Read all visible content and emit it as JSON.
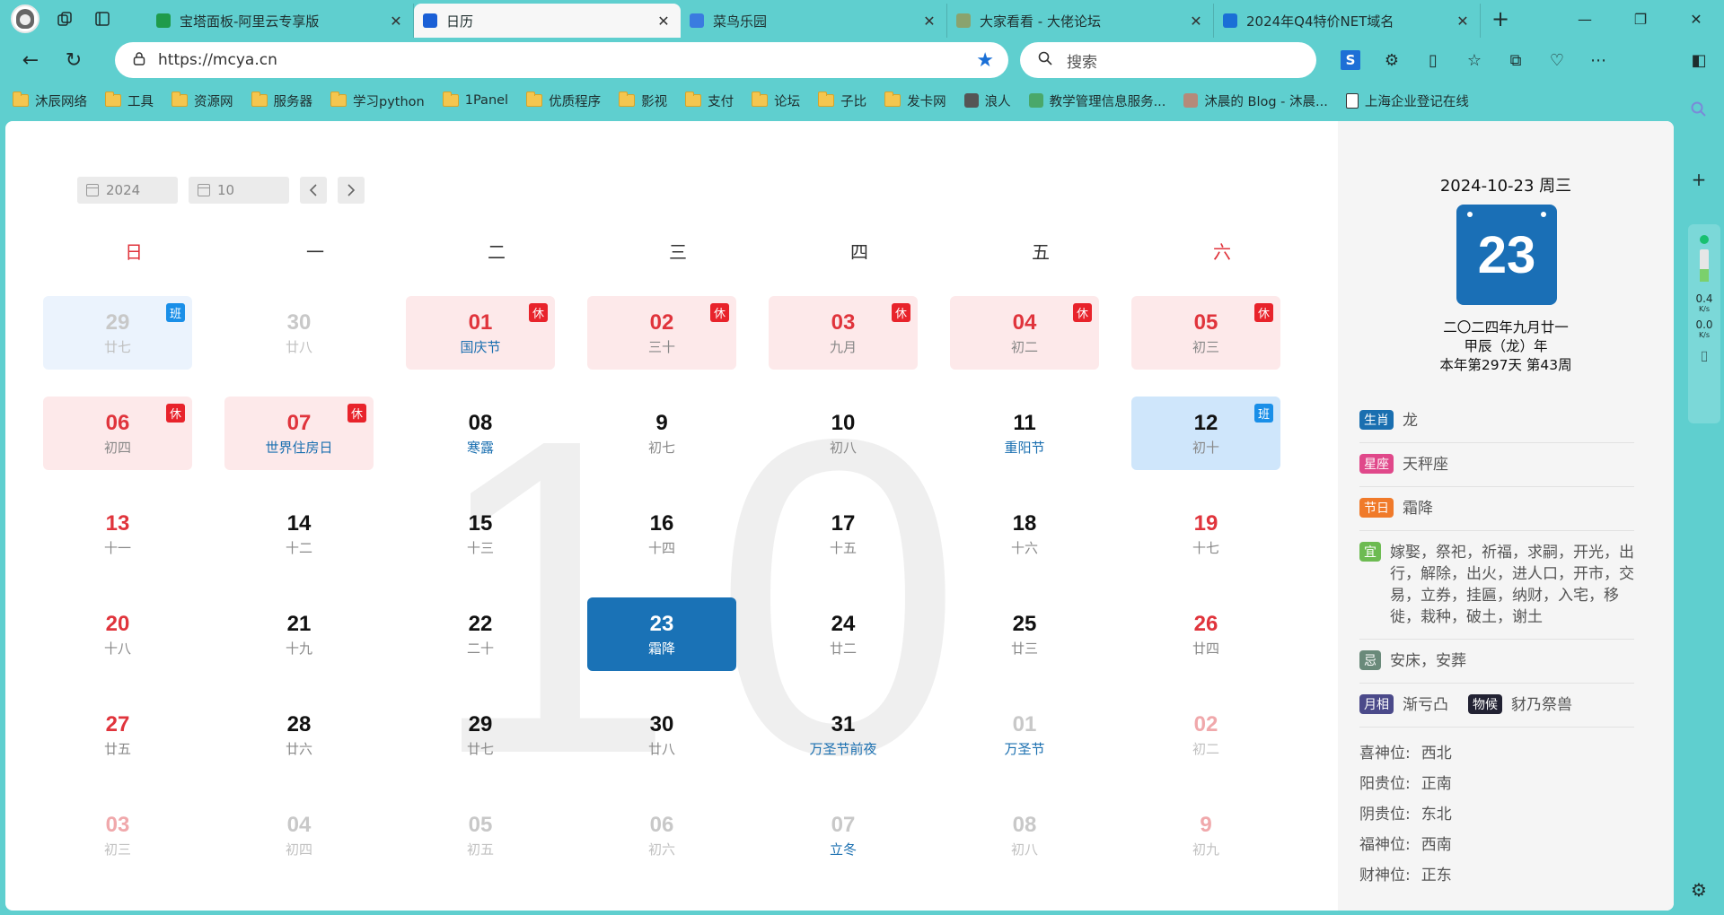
{
  "browser": {
    "tabs": [
      {
        "title": "宝塔面板-阿里云专享版",
        "favicon_color": "#1f9b4b",
        "active": false
      },
      {
        "title": "日历",
        "favicon_color": "#1a5fd6",
        "active": true
      },
      {
        "title": "菜鸟乐园",
        "favicon_color": "#3a7be0",
        "active": false
      },
      {
        "title": "大家看看 - 大佬论坛",
        "favicon_color": "#8aa36e",
        "active": false
      },
      {
        "title": "2024年Q4特价NET域名",
        "favicon_color": "#1a6fd6",
        "active": false
      }
    ],
    "url": "https://mcya.cn",
    "search_placeholder": "搜索",
    "bookmarks": [
      {
        "label": "沐辰网络",
        "type": "folder"
      },
      {
        "label": "工具",
        "type": "folder"
      },
      {
        "label": "资源网",
        "type": "folder"
      },
      {
        "label": "服务器",
        "type": "folder"
      },
      {
        "label": "学习python",
        "type": "folder"
      },
      {
        "label": "1Panel",
        "type": "folder"
      },
      {
        "label": "优质程序",
        "type": "folder"
      },
      {
        "label": "影视",
        "type": "folder"
      },
      {
        "label": "支付",
        "type": "folder"
      },
      {
        "label": "论坛",
        "type": "folder"
      },
      {
        "label": "子比",
        "type": "folder"
      },
      {
        "label": "发卡网",
        "type": "folder"
      },
      {
        "label": "浪人",
        "type": "site"
      },
      {
        "label": "教学管理信息服务...",
        "type": "site"
      },
      {
        "label": "沐晨的 Blog - 沐晨...",
        "type": "site"
      },
      {
        "label": "上海企业登记在线",
        "type": "doc"
      }
    ],
    "net_up": "0.4",
    "net_down": "0.0",
    "net_unit": "K/s"
  },
  "calendar": {
    "year": "2024",
    "month": "10",
    "big_month": "10",
    "weekdays": [
      "日",
      "一",
      "二",
      "三",
      "四",
      "五",
      "六"
    ],
    "days": [
      {
        "num": "29",
        "sub": "廿七",
        "style": "lightblue",
        "numColor": "gray",
        "subColor": "gray",
        "badge": "班"
      },
      {
        "num": "30",
        "sub": "廿八",
        "style": "",
        "numColor": "gray",
        "subColor": "gray"
      },
      {
        "num": "01",
        "sub": "国庆节",
        "style": "pink",
        "numColor": "red",
        "fest": true,
        "badge": "休"
      },
      {
        "num": "02",
        "sub": "三十",
        "style": "pink",
        "numColor": "red",
        "badge": "休"
      },
      {
        "num": "03",
        "sub": "九月",
        "style": "pink",
        "numColor": "red",
        "badge": "休"
      },
      {
        "num": "04",
        "sub": "初二",
        "style": "pink",
        "numColor": "red",
        "badge": "休"
      },
      {
        "num": "05",
        "sub": "初三",
        "style": "pink",
        "numColor": "red",
        "badge": "休"
      },
      {
        "num": "06",
        "sub": "初四",
        "style": "pink",
        "numColor": "red",
        "badge": "休"
      },
      {
        "num": "07",
        "sub": "世界住房日",
        "style": "pink",
        "numColor": "red",
        "fest": true,
        "badge": "休"
      },
      {
        "num": "08",
        "sub": "寒露",
        "style": "",
        "numColor": "black",
        "fest": true
      },
      {
        "num": "9",
        "sub": "初七",
        "style": "",
        "numColor": "black"
      },
      {
        "num": "10",
        "sub": "初八",
        "style": "",
        "numColor": "black"
      },
      {
        "num": "11",
        "sub": "重阳节",
        "style": "",
        "numColor": "black",
        "fest": true
      },
      {
        "num": "12",
        "sub": "初十",
        "style": "blue",
        "numColor": "black",
        "badge": "班"
      },
      {
        "num": "13",
        "sub": "十一",
        "style": "",
        "numColor": "red"
      },
      {
        "num": "14",
        "sub": "十二",
        "style": "",
        "numColor": "black"
      },
      {
        "num": "15",
        "sub": "十三",
        "style": "",
        "numColor": "black"
      },
      {
        "num": "16",
        "sub": "十四",
        "style": "",
        "numColor": "black"
      },
      {
        "num": "17",
        "sub": "十五",
        "style": "",
        "numColor": "black"
      },
      {
        "num": "18",
        "sub": "十六",
        "style": "",
        "numColor": "black"
      },
      {
        "num": "19",
        "sub": "十七",
        "style": "",
        "numColor": "red"
      },
      {
        "num": "20",
        "sub": "十八",
        "style": "",
        "numColor": "red"
      },
      {
        "num": "21",
        "sub": "十九",
        "style": "",
        "numColor": "black"
      },
      {
        "num": "22",
        "sub": "二十",
        "style": "",
        "numColor": "black"
      },
      {
        "num": "23",
        "sub": "霜降",
        "style": "today",
        "numColor": "black"
      },
      {
        "num": "24",
        "sub": "廿二",
        "style": "",
        "numColor": "black"
      },
      {
        "num": "25",
        "sub": "廿三",
        "style": "",
        "numColor": "black"
      },
      {
        "num": "26",
        "sub": "廿四",
        "style": "",
        "numColor": "red"
      },
      {
        "num": "27",
        "sub": "廿五",
        "style": "",
        "numColor": "red"
      },
      {
        "num": "28",
        "sub": "廿六",
        "style": "",
        "numColor": "black"
      },
      {
        "num": "29",
        "sub": "廿七",
        "style": "",
        "numColor": "black"
      },
      {
        "num": "30",
        "sub": "廿八",
        "style": "",
        "numColor": "black"
      },
      {
        "num": "31",
        "sub": "万圣节前夜",
        "style": "",
        "numColor": "black",
        "fest": true
      },
      {
        "num": "01",
        "sub": "万圣节",
        "style": "",
        "numColor": "gray",
        "fest": true
      },
      {
        "num": "02",
        "sub": "初二",
        "style": "",
        "numColor": "pinkgray",
        "subColor": "gray"
      },
      {
        "num": "03",
        "sub": "初三",
        "style": "",
        "numColor": "pinkgray",
        "subColor": "gray"
      },
      {
        "num": "04",
        "sub": "初四",
        "style": "",
        "numColor": "gray",
        "subColor": "gray"
      },
      {
        "num": "05",
        "sub": "初五",
        "style": "",
        "numColor": "gray",
        "subColor": "gray"
      },
      {
        "num": "06",
        "sub": "初六",
        "style": "",
        "numColor": "gray",
        "subColor": "gray"
      },
      {
        "num": "07",
        "sub": "立冬",
        "style": "",
        "numColor": "gray",
        "fest": true
      },
      {
        "num": "08",
        "sub": "初八",
        "style": "",
        "numColor": "gray",
        "subColor": "gray"
      },
      {
        "num": "9",
        "sub": "初九",
        "style": "",
        "numColor": "pinkgray",
        "subColor": "gray"
      }
    ]
  },
  "panel": {
    "date": "2024-10-23 周三",
    "big_day": "23",
    "lunar1": "二〇二四年九月廿一",
    "lunar2": "甲辰（龙）年",
    "lunar3": "本年第297天 第43周",
    "rows": [
      {
        "tag": "生肖",
        "color": "#1a6fb0",
        "value": "龙"
      },
      {
        "tag": "星座",
        "color": "#e0488a",
        "value": "天秤座"
      },
      {
        "tag": "节日",
        "color": "#f07a2a",
        "value": "霜降"
      },
      {
        "tag": "宜",
        "color": "#6dbb52",
        "value": "嫁娶，祭祀，祈福，求嗣，开光，出行，解除，出火，进人口，开市，交易，立券，挂匾，纳财，入宅，移徙，栽种，破土，谢土"
      },
      {
        "tag": "忌",
        "color": "#6a8a7a",
        "value": "安床，安葬"
      }
    ],
    "moon": {
      "tag": "月相",
      "color": "#4b4a8a",
      "value": "渐亏凸"
    },
    "phenology": {
      "tag": "物候",
      "color": "#222233",
      "value": "豺乃祭兽"
    },
    "positions": [
      {
        "label": "喜神位:",
        "value": "西北"
      },
      {
        "label": "阳贵位:",
        "value": "正南"
      },
      {
        "label": "阴贵位:",
        "value": "东北"
      },
      {
        "label": "福神位:",
        "value": "西南"
      },
      {
        "label": "财神位:",
        "value": "正东"
      }
    ]
  }
}
